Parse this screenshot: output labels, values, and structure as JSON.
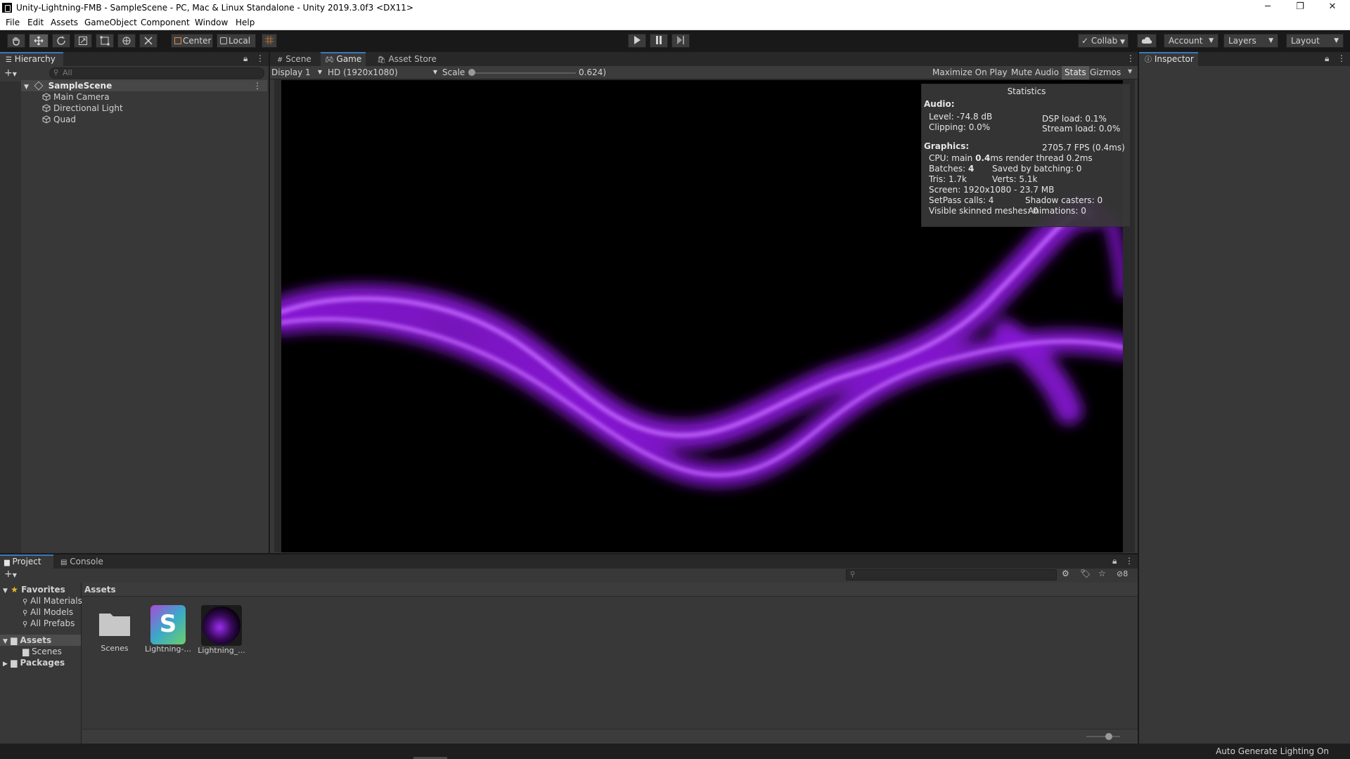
{
  "window": {
    "title": "Unity-Lightning-FMB - SampleScene - PC, Mac & Linux Standalone - Unity 2019.3.0f3 <DX11>",
    "controls": {
      "minimize": "─",
      "maximize": "❐",
      "close": "✕"
    }
  },
  "menu": [
    "File",
    "Edit",
    "Assets",
    "GameObject",
    "Component",
    "Window",
    "Help"
  ],
  "toolbar": {
    "pivot_label": "Center",
    "space_label": "Local",
    "collab_label": "Collab",
    "account_label": "Account",
    "layers_label": "Layers",
    "layout_label": "Layout"
  },
  "hierarchy": {
    "tab_label": "Hierarchy",
    "search_placeholder": "All",
    "scene_name": "SampleScene",
    "items": [
      "Main Camera",
      "Directional Light",
      "Quad"
    ]
  },
  "center_tabs": {
    "scene": "Scene",
    "game": "Game",
    "asset_store": "Asset Store"
  },
  "game_toolbar": {
    "display": "Display 1",
    "resolution": "HD (1920x1080)",
    "scale_label": "Scale",
    "scale_value": "0.624)",
    "maximize_on_play": "Maximize On Play",
    "mute_audio": "Mute Audio",
    "stats": "Stats",
    "gizmos": "Gizmos"
  },
  "statistics": {
    "title": "Statistics",
    "audio_header": "Audio:",
    "level": "Level: -74.8 dB",
    "clipping": "Clipping: 0.0%",
    "dsp_load": "DSP load: 0.1%",
    "stream_load": "Stream load: 0.0%",
    "graphics_header": "Graphics:",
    "fps": "2705.7 FPS (0.4ms)",
    "cpu_prefix": "CPU: main ",
    "cpu_main": "0.4",
    "cpu_suffix": "ms  render thread 0.2ms",
    "batches_prefix": "Batches: ",
    "batches": "4",
    "saved_by_batching": "Saved by batching: 0",
    "tris": "Tris: 1.7k",
    "verts": "Verts: 5.1k",
    "screen": "Screen: 1920x1080 - 23.7 MB",
    "setpass": "SetPass calls: 4",
    "shadow_casters": "Shadow casters: 0",
    "visible_skinned": "Visible skinned meshes: 0",
    "animations": "Animations: 0"
  },
  "inspector": {
    "tab_label": "Inspector"
  },
  "bottom_tabs": {
    "project": "Project",
    "console": "Console"
  },
  "project": {
    "favorites_label": "Favorites",
    "favorites": [
      "All Materials",
      "All Models",
      "All Prefabs"
    ],
    "assets_label": "Assets",
    "assets_children": [
      "Scenes"
    ],
    "packages_label": "Packages",
    "breadcrumb": "Assets",
    "hidden_count": "8",
    "items": [
      {
        "label": "Scenes",
        "icon": "folder-icon"
      },
      {
        "label": "Lightning-...",
        "icon": "shader-icon"
      },
      {
        "label": "Lightning_...",
        "icon": "material-icon"
      }
    ]
  },
  "status": {
    "text": "Auto Generate Lighting On"
  },
  "colors": {
    "accent": "#3a79bb",
    "lightning": "#a020f0",
    "panel": "#383838",
    "dark": "#191919"
  }
}
